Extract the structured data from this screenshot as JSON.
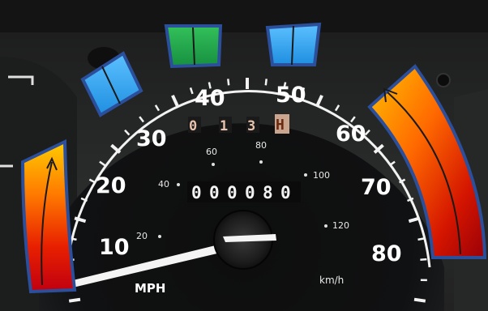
{
  "dashboard": {
    "mph_labels": [
      "10",
      "20",
      "30",
      "40",
      "50",
      "60",
      "70",
      "80"
    ],
    "kmh_labels": [
      "20",
      "40",
      "60",
      "80",
      "100",
      "120"
    ],
    "unit_mph": "MPH",
    "unit_kmh": "km/h",
    "odometer_digits": [
      "0",
      "0",
      "0",
      "0",
      "8",
      "0"
    ],
    "trip_digits": [
      "0",
      "1",
      "3"
    ],
    "trip_last_digit": "H",
    "needle_mph": 7
  },
  "annotations": {
    "zones": [
      {
        "color": "green",
        "hex": "#22aa44"
      },
      {
        "color": "blue",
        "hex": "#2fa3e8"
      },
      {
        "color": "red",
        "hex": "#cc0000"
      },
      {
        "color": "orange",
        "hex": "#ffa000"
      }
    ],
    "outline_color": "#2b4f9a"
  }
}
